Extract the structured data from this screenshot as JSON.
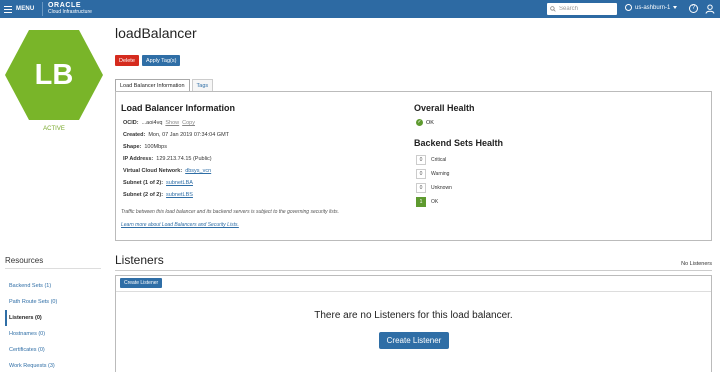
{
  "header": {
    "menu_label": "MENU",
    "logo_line1": "ORACLE",
    "logo_line2": "Cloud Infrastructure",
    "search_placeholder": "Search",
    "region": "us-ashburn-1",
    "help": "?"
  },
  "resource": {
    "badge": "LB",
    "badge_color": "#79b529",
    "status": "ACTIVE",
    "title": "loadBalancer"
  },
  "actions": {
    "delete": "Delete",
    "apply_tags": "Apply Tag(s)"
  },
  "tabs": [
    {
      "label": "Load Balancer Information"
    },
    {
      "label": "Tags"
    }
  ],
  "info": {
    "heading": "Load Balancer Information",
    "ocid_label": "OCID:",
    "ocid_value": "...aoi4vq",
    "show": "Show",
    "copy": "Copy",
    "created_label": "Created:",
    "created_value": "Mon, 07 Jan 2019 07:34:04 GMT",
    "shape_label": "Shape:",
    "shape_value": "100Mbps",
    "ip_label": "IP Address:",
    "ip_value": "129.213.74.15 (Public)",
    "vcn_label": "Virtual Cloud Network:",
    "vcn_value": "dbsys_vcn",
    "subnet1_label": "Subnet (1 of 2):",
    "subnet1_value": "subnetLBA",
    "subnet2_label": "Subnet (2 of 2):",
    "subnet2_value": "subnetLBS",
    "note": "Traffic between this load balancer and its backend servers is subject to the governing security lists.",
    "learn_more": "Learn more about Load Balancers and Security Lists."
  },
  "health": {
    "overall_heading": "Overall Health",
    "overall_status": "OK",
    "backend_heading": "Backend Sets Health",
    "items": [
      {
        "count": "0",
        "label": "Critical"
      },
      {
        "count": "0",
        "label": "Warning"
      },
      {
        "count": "0",
        "label": "Unknown"
      },
      {
        "count": "1",
        "label": "OK"
      }
    ]
  },
  "sidebar": {
    "title": "Resources",
    "items": [
      {
        "label": "Backend Sets (1)"
      },
      {
        "label": "Path Route Sets (0)"
      },
      {
        "label": "Listeners (0)"
      },
      {
        "label": "Hostnames (0)"
      },
      {
        "label": "Certificates (0)"
      },
      {
        "label": "Work Requests (3)"
      }
    ]
  },
  "listeners": {
    "title": "Listeners",
    "count_text": "No Listeners",
    "create_small": "Create Listener",
    "empty_message": "There are no Listeners for this load balancer.",
    "create_big": "Create Listener"
  }
}
